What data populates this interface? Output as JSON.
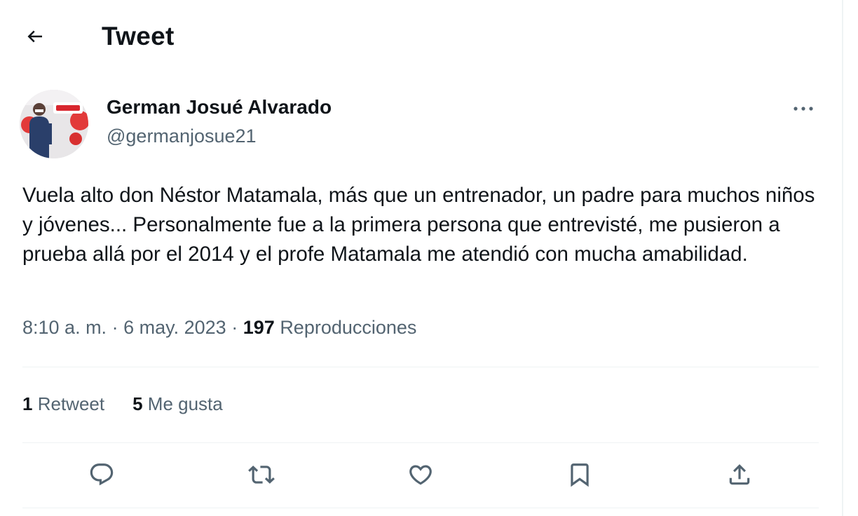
{
  "header": {
    "title": "Tweet",
    "back_icon": "arrow-left-icon"
  },
  "author": {
    "name": "German Josué Alvarado",
    "handle": "@germanjosue21"
  },
  "tweet": {
    "text": "Vuela alto don Néstor Matamala, más que un entrenador, un padre para muchos niños y jóvenes... Personalmente fue a la primera persona que entrevisté, me pusieron a prueba allá por el 2014 y el profe Matamala me atendió con mucha amabilidad.",
    "time": "8:10 a. m.",
    "date": "6 may. 2023",
    "separator": "·",
    "views_count": "197",
    "views_label": "Reproducciones"
  },
  "stats": {
    "retweets_count": "1",
    "retweets_label": "Retweet",
    "likes_count": "5",
    "likes_label": "Me gusta"
  },
  "actions": {
    "icons": [
      "reply-icon",
      "retweet-icon",
      "like-icon",
      "bookmark-icon",
      "share-icon"
    ]
  },
  "colors": {
    "text_primary": "#0f1419",
    "text_secondary": "#536471",
    "divider": "#eff3f4"
  }
}
